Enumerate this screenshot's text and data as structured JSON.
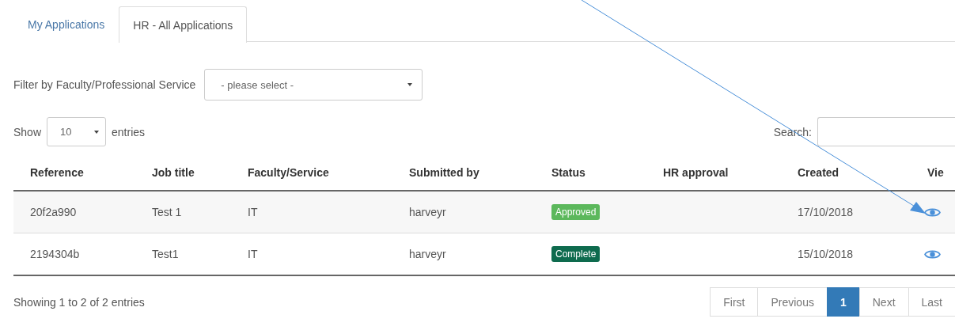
{
  "tabs": [
    {
      "label": "My Applications",
      "selected": false
    },
    {
      "label": "HR - All Applications",
      "selected": true
    }
  ],
  "filter": {
    "label": "Filter by Faculty/Professional Service",
    "value": "- please select -"
  },
  "length": {
    "prefix": "Show",
    "value": "10",
    "suffix": "entries"
  },
  "search": {
    "label": "Search:"
  },
  "table": {
    "columns": [
      "Reference",
      "Job title",
      "Faculty/Service",
      "Submitted by",
      "Status",
      "HR approval",
      "Created",
      "Vie"
    ],
    "rows": [
      {
        "reference": "20f2a990",
        "job_title": "Test 1",
        "faculty": "IT",
        "submitted_by": "harveyr",
        "status": {
          "label": "Approved",
          "color": "#5cb85c"
        },
        "created": "17/10/2018"
      },
      {
        "reference": "2194304b",
        "job_title": "Test1",
        "faculty": "IT",
        "submitted_by": "harveyr",
        "status": {
          "label": "Complete",
          "color": "#0e6b4e"
        },
        "created": "15/10/2018"
      }
    ]
  },
  "info": "Showing 1 to 2 of 2 entries",
  "pagination": [
    {
      "label": "First",
      "selected": false
    },
    {
      "label": "Previous",
      "selected": false
    },
    {
      "label": "1",
      "selected": true
    },
    {
      "label": "Next",
      "selected": false
    },
    {
      "label": "Last",
      "selected": false
    }
  ]
}
